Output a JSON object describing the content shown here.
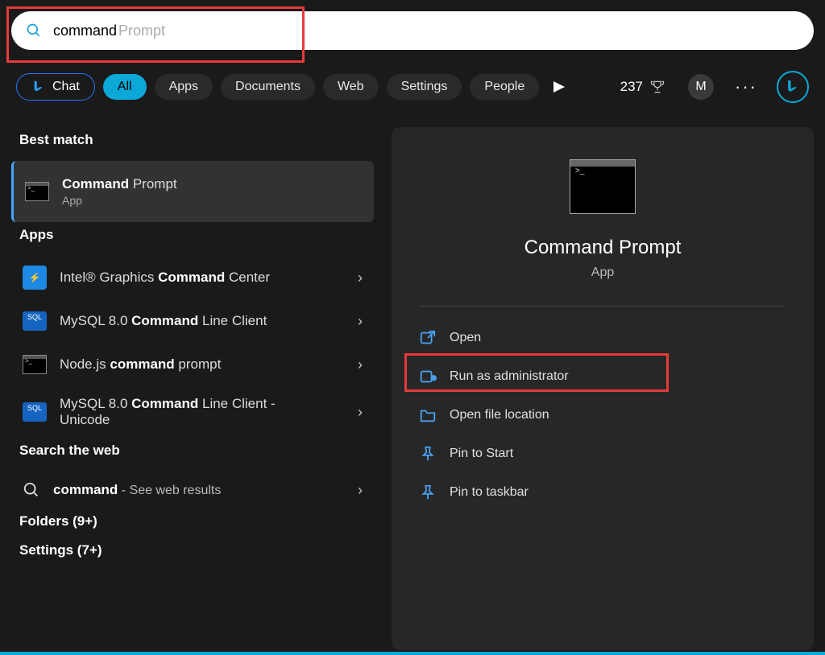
{
  "search": {
    "typed": "command",
    "suggestion": " Prompt"
  },
  "filters": {
    "chat": "Chat",
    "all": "All",
    "apps": "Apps",
    "documents": "Documents",
    "web": "Web",
    "settings": "Settings",
    "people": "People"
  },
  "points": "237",
  "avatar_initial": "M",
  "left": {
    "best_match_label": "Best match",
    "best": {
      "title_bold": "Command",
      "title_rest": " Prompt",
      "sub": "App"
    },
    "apps_label": "Apps",
    "apps": [
      {
        "pre": "Intel® Graphics ",
        "bold": "Command",
        "post": " Center"
      },
      {
        "pre": "MySQL 8.0 ",
        "bold": "Command",
        "post": " Line Client"
      },
      {
        "pre": "Node.js ",
        "bold": "command",
        "post": " prompt"
      },
      {
        "pre": "MySQL 8.0 ",
        "bold": "Command",
        "post": " Line Client - Unicode"
      }
    ],
    "web_label": "Search the web",
    "web_item_bold": "command",
    "web_item_rest": " - See web results",
    "folders_label": "Folders (9+)",
    "settings_label": "Settings (7+)"
  },
  "right": {
    "title": "Command Prompt",
    "sub": "App",
    "actions": {
      "open": "Open",
      "admin": "Run as administrator",
      "location": "Open file location",
      "pin_start": "Pin to Start",
      "pin_taskbar": "Pin to taskbar"
    }
  }
}
